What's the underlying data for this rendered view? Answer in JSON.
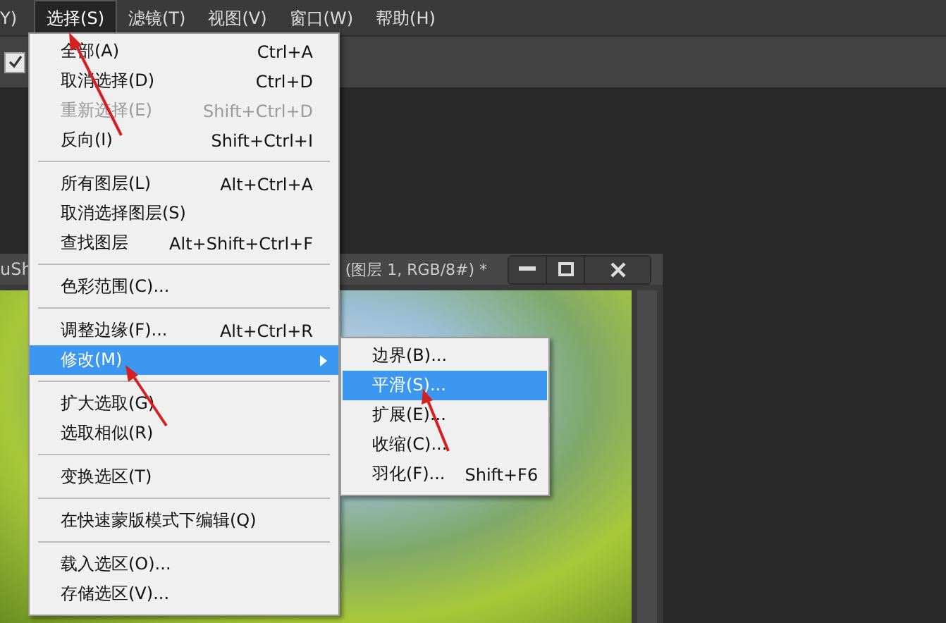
{
  "menu_bar": {
    "items": [
      {
        "label": "Y)",
        "selected": false
      },
      {
        "label": "选择(S)",
        "selected": true
      },
      {
        "label": "滤镜(T)",
        "selected": false
      },
      {
        "label": "视图(V)",
        "selected": false
      },
      {
        "label": "窗口(W)",
        "selected": false
      },
      {
        "label": "帮助(H)",
        "selected": false
      }
    ]
  },
  "options_bar": {
    "checkbox": {
      "checked": true
    }
  },
  "document": {
    "title_left": "uSh",
    "title_right": "(图层 1, RGB/8#) *"
  },
  "menu": {
    "sections": [
      [
        {
          "label": "全部(A)",
          "shortcut": "Ctrl+A",
          "disabled": false,
          "selected": false,
          "submenu": false
        },
        {
          "label": "取消选择(D)",
          "shortcut": "Ctrl+D",
          "disabled": false,
          "selected": false,
          "submenu": false
        },
        {
          "label": "重新选择(E)",
          "shortcut": "Shift+Ctrl+D",
          "disabled": true,
          "selected": false,
          "submenu": false
        },
        {
          "label": "反向(I)",
          "shortcut": "Shift+Ctrl+I",
          "disabled": false,
          "selected": false,
          "submenu": false
        }
      ],
      [
        {
          "label": "所有图层(L)",
          "shortcut": "Alt+Ctrl+A",
          "disabled": false,
          "selected": false,
          "submenu": false
        },
        {
          "label": "取消选择图层(S)",
          "disabled": false,
          "selected": false,
          "submenu": false
        },
        {
          "label": "查找图层",
          "shortcut": "Alt+Shift+Ctrl+F",
          "disabled": false,
          "selected": false,
          "submenu": false
        }
      ],
      [
        {
          "label": "色彩范围(C)...",
          "disabled": false,
          "selected": false,
          "submenu": false
        }
      ],
      [
        {
          "label": "调整边缘(F)...",
          "shortcut": "Alt+Ctrl+R",
          "disabled": false,
          "selected": false,
          "submenu": false
        },
        {
          "label": "修改(M)",
          "disabled": false,
          "selected": true,
          "submenu": true
        }
      ],
      [
        {
          "label": "扩大选取(G)",
          "disabled": false,
          "selected": false,
          "submenu": false
        },
        {
          "label": "选取相似(R)",
          "disabled": false,
          "selected": false,
          "submenu": false
        }
      ],
      [
        {
          "label": "变换选区(T)",
          "disabled": false,
          "selected": false,
          "submenu": false
        }
      ],
      [
        {
          "label": "在快速蒙版模式下编辑(Q)",
          "disabled": false,
          "selected": false,
          "submenu": false
        }
      ],
      [
        {
          "label": "载入选区(O)...",
          "disabled": false,
          "selected": false,
          "submenu": false
        },
        {
          "label": "存储选区(V)...",
          "disabled": false,
          "selected": false,
          "submenu": false
        }
      ]
    ]
  },
  "submenu": {
    "items": [
      {
        "label": "边界(B)...",
        "selected": false
      },
      {
        "label": "平滑(S)...",
        "selected": true
      },
      {
        "label": "扩展(E)...",
        "selected": false
      },
      {
        "label": "收缩(C)...",
        "selected": false
      },
      {
        "label": "羽化(F)...",
        "shortcut": "Shift+F6",
        "selected": false
      }
    ]
  }
}
